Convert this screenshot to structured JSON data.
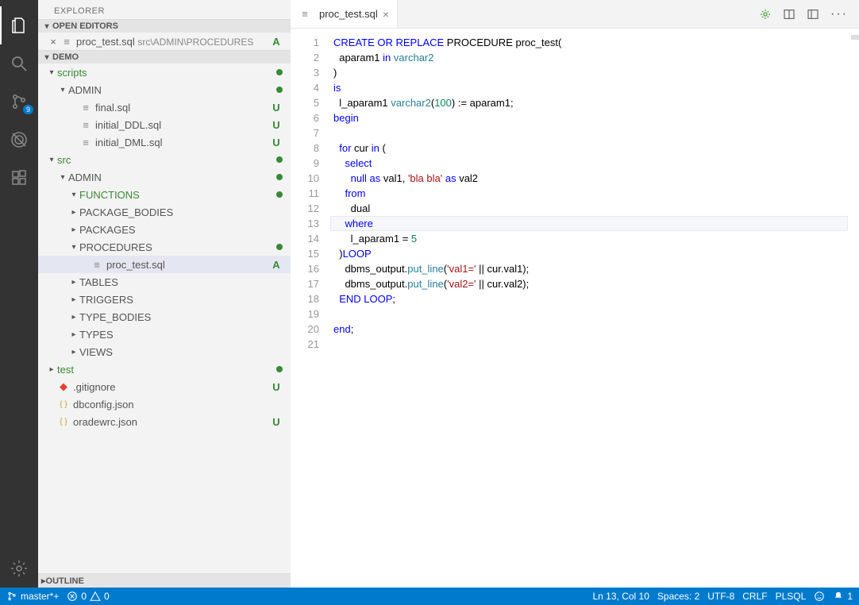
{
  "sidebar": {
    "title": "EXPLORER",
    "openEditorsHeader": "OPEN EDITORS",
    "openEditor": {
      "name": "proc_test.sql",
      "path": "src\\ADMIN\\PROCEDURES",
      "status": "A"
    },
    "workspaceName": "DEMO",
    "outlineHeader": "OUTLINE",
    "tree": [
      {
        "depth": 0,
        "kind": "folder",
        "open": true,
        "label": "scripts",
        "status": "dot",
        "color": "green"
      },
      {
        "depth": 1,
        "kind": "folder",
        "open": true,
        "label": "ADMIN",
        "status": "dot"
      },
      {
        "depth": 2,
        "kind": "file",
        "label": "final.sql",
        "status": "U"
      },
      {
        "depth": 2,
        "kind": "file",
        "label": "initial_DDL.sql",
        "status": "U"
      },
      {
        "depth": 2,
        "kind": "file",
        "label": "initial_DML.sql",
        "status": "U"
      },
      {
        "depth": 0,
        "kind": "folder",
        "open": true,
        "label": "src",
        "status": "dot",
        "color": "green"
      },
      {
        "depth": 1,
        "kind": "folder",
        "open": true,
        "label": "ADMIN",
        "status": "dot"
      },
      {
        "depth": 2,
        "kind": "folder",
        "open": true,
        "label": "FUNCTIONS",
        "status": "dot",
        "color": "green"
      },
      {
        "depth": 2,
        "kind": "folder",
        "open": false,
        "label": "PACKAGE_BODIES"
      },
      {
        "depth": 2,
        "kind": "folder",
        "open": false,
        "label": "PACKAGES"
      },
      {
        "depth": 2,
        "kind": "folder",
        "open": true,
        "label": "PROCEDURES",
        "status": "dot",
        "selectedParent": true
      },
      {
        "depth": 3,
        "kind": "file",
        "label": "proc_test.sql",
        "status": "A",
        "selected": true
      },
      {
        "depth": 2,
        "kind": "folder",
        "open": false,
        "label": "TABLES"
      },
      {
        "depth": 2,
        "kind": "folder",
        "open": false,
        "label": "TRIGGERS"
      },
      {
        "depth": 2,
        "kind": "folder",
        "open": false,
        "label": "TYPE_BODIES"
      },
      {
        "depth": 2,
        "kind": "folder",
        "open": false,
        "label": "TYPES"
      },
      {
        "depth": 2,
        "kind": "folder",
        "open": false,
        "label": "VIEWS"
      },
      {
        "depth": 0,
        "kind": "folder",
        "open": false,
        "label": "test",
        "status": "dot",
        "color": "green"
      },
      {
        "depth": 0,
        "kind": "file",
        "label": ".gitignore",
        "status": "U",
        "icon": "git"
      },
      {
        "depth": 0,
        "kind": "file",
        "label": "dbconfig.json",
        "icon": "braces"
      },
      {
        "depth": 0,
        "kind": "file",
        "label": "oradewrc.json",
        "status": "U",
        "icon": "braces"
      }
    ]
  },
  "activityBar": {
    "scmBadge": "9"
  },
  "tab": {
    "name": "proc_test.sql"
  },
  "code": {
    "lines": [
      [
        [
          "kw",
          "CREATE OR REPLACE"
        ],
        [
          "op",
          " PROCEDURE proc_test("
        ]
      ],
      [
        [
          "op",
          "  aparam1 "
        ],
        [
          "kw",
          "in"
        ],
        [
          "op",
          " "
        ],
        [
          "fn",
          "varchar2"
        ]
      ],
      [
        [
          "op",
          ")"
        ]
      ],
      [
        [
          "kw",
          "is"
        ]
      ],
      [
        [
          "op",
          "  l_aparam1 "
        ],
        [
          "fn",
          "varchar2"
        ],
        [
          "op",
          "("
        ],
        [
          "num",
          "100"
        ],
        [
          "op",
          ") := aparam1;"
        ]
      ],
      [
        [
          "kw",
          "begin"
        ]
      ],
      [
        [
          "op",
          ""
        ]
      ],
      [
        [
          "op",
          "  "
        ],
        [
          "kw",
          "for"
        ],
        [
          "op",
          " cur "
        ],
        [
          "kw",
          "in"
        ],
        [
          "op",
          " ("
        ]
      ],
      [
        [
          "op",
          "    "
        ],
        [
          "kw",
          "select"
        ]
      ],
      [
        [
          "op",
          "      "
        ],
        [
          "kw",
          "null as"
        ],
        [
          "op",
          " val1, "
        ],
        [
          "str",
          "'bla bla'"
        ],
        [
          "op",
          " "
        ],
        [
          "kw",
          "as"
        ],
        [
          "op",
          " val2"
        ]
      ],
      [
        [
          "op",
          "    "
        ],
        [
          "kw",
          "from"
        ]
      ],
      [
        [
          "op",
          "      dual"
        ]
      ],
      [
        [
          "op",
          "    "
        ],
        [
          "kw",
          "where"
        ]
      ],
      [
        [
          "op",
          "      l_aparam1 = "
        ],
        [
          "num",
          "5"
        ]
      ],
      [
        [
          "op",
          "  )"
        ],
        [
          "kw",
          "LOOP"
        ]
      ],
      [
        [
          "op",
          "    dbms_output."
        ],
        [
          "fn",
          "put_line"
        ],
        [
          "op",
          "("
        ],
        [
          "str",
          "'val1='"
        ],
        [
          "op",
          " || cur.val1);"
        ]
      ],
      [
        [
          "op",
          "    dbms_output."
        ],
        [
          "fn",
          "put_line"
        ],
        [
          "op",
          "("
        ],
        [
          "str",
          "'val2='"
        ],
        [
          "op",
          " || cur.val2);"
        ]
      ],
      [
        [
          "op",
          "  "
        ],
        [
          "kw",
          "END LOOP"
        ],
        [
          "op",
          ";"
        ]
      ],
      [
        [
          "op",
          ""
        ]
      ],
      [
        [
          "kw",
          "end"
        ],
        [
          "op",
          ";"
        ]
      ],
      [
        [
          "op",
          ""
        ]
      ]
    ],
    "currentLine": 13
  },
  "status": {
    "branch": "master*+",
    "errors": "0",
    "warnings": "0",
    "lncol": "Ln 13, Col 10",
    "spaces": "Spaces: 2",
    "encoding": "UTF-8",
    "eol": "CRLF",
    "lang": "PLSQL",
    "notifications": "1"
  }
}
